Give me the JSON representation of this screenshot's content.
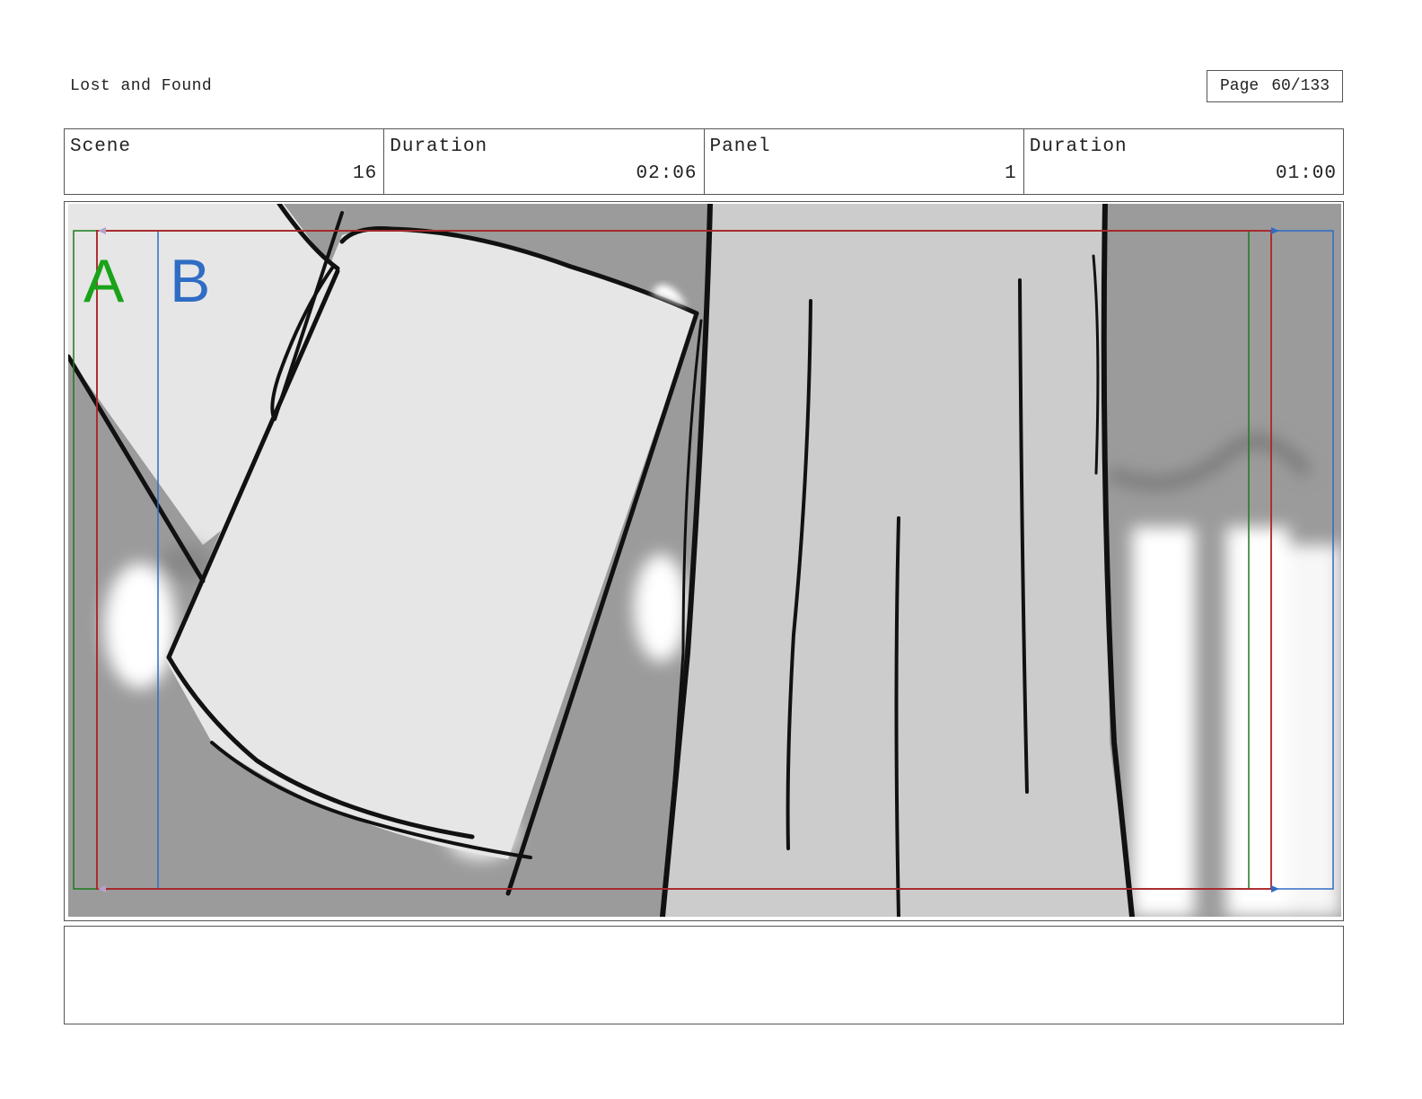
{
  "header": {
    "project_title": "Lost and Found",
    "page_label": "Page",
    "page_value": "60/133"
  },
  "info": {
    "scene_label": "Scene",
    "scene_value": "16",
    "scene_duration_label": "Duration",
    "scene_duration_value": "02:06",
    "panel_label": "Panel",
    "panel_value": "1",
    "panel_duration_label": "Duration",
    "panel_duration_value": "01:00"
  },
  "panel": {
    "guide_a_label": "A",
    "guide_b_label": "B",
    "guide_a_color": "#1aa31a",
    "guide_b_color": "#2f6cc4",
    "safe_frame_color": "#b22222"
  },
  "notes": {
    "text": ""
  }
}
